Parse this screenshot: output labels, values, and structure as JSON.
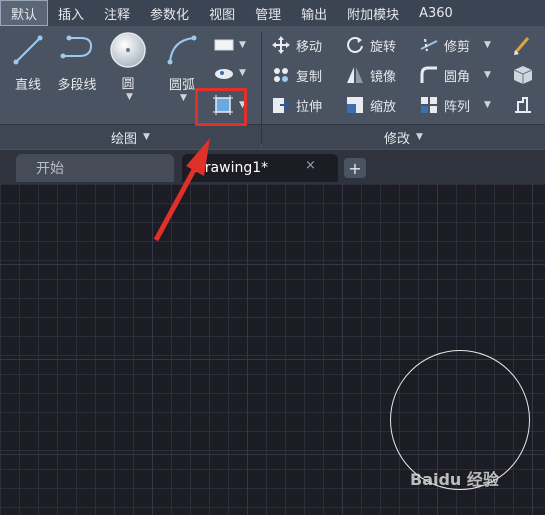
{
  "menu": [
    "默认",
    "插入",
    "注释",
    "参数化",
    "视图",
    "管理",
    "输出",
    "附加模块",
    "A360"
  ],
  "draw_panel": {
    "tools": {
      "line": "直线",
      "polyline": "多段线",
      "circle": "圆",
      "arc": "圆弧"
    },
    "footer": "绘图"
  },
  "modify_panel": {
    "rows": [
      [
        "移动",
        "旋转",
        "修剪"
      ],
      [
        "复制",
        "镜像",
        "圆角"
      ],
      [
        "拉伸",
        "缩放",
        "阵列"
      ]
    ],
    "footer": "修改"
  },
  "tabs": {
    "start": "开始",
    "drawing": "Drawing1*",
    "close": "×",
    "add": "+"
  },
  "watermark": "Baidu 经验",
  "colors": {
    "highlight": "#e0302a",
    "canvas": "#1c1c24",
    "ribbon": "#4a5361"
  }
}
